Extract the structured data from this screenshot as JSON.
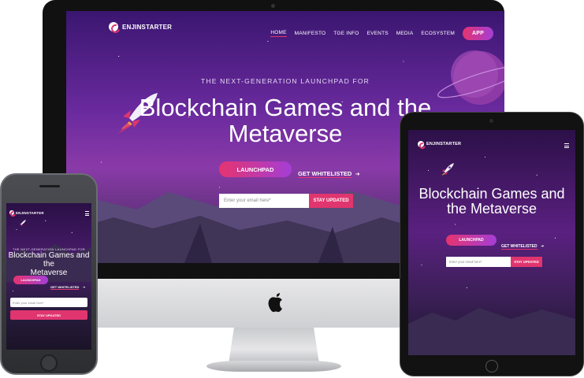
{
  "brand": {
    "name": "ENJINSTARTER",
    "accent": "#e0356f",
    "accent2": "#a43ed6"
  },
  "nav": {
    "items": [
      "HOME",
      "MANIFESTO",
      "TGE INFO",
      "EVENTS",
      "MEDIA",
      "ECOSYSTEM"
    ],
    "app_label": "APP"
  },
  "hero": {
    "eyebrow": "THE NEXT-GENERATION LAUNCHPAD FOR",
    "headline_line1": "Blockchain Games and the",
    "headline_line2": "Metaverse",
    "tablet_line1": "Blockchain Games and",
    "tablet_line2": "the Metaverse",
    "phone_line1": "Blockchain Games and the",
    "phone_line2": "Metaverse",
    "launchpad_label": "LAUNCHPAD",
    "whitelist_label": "GET WHITELISTED",
    "email_placeholder": "Enter your email here*",
    "submit_label": "STAY UPDATED"
  },
  "icons": {
    "logo": "enjinstarter-logo-icon",
    "rocket": "rocket-icon",
    "arrow": "arrow-right-icon",
    "menu": "hamburger-menu-icon",
    "apple": "apple-logo-icon"
  }
}
